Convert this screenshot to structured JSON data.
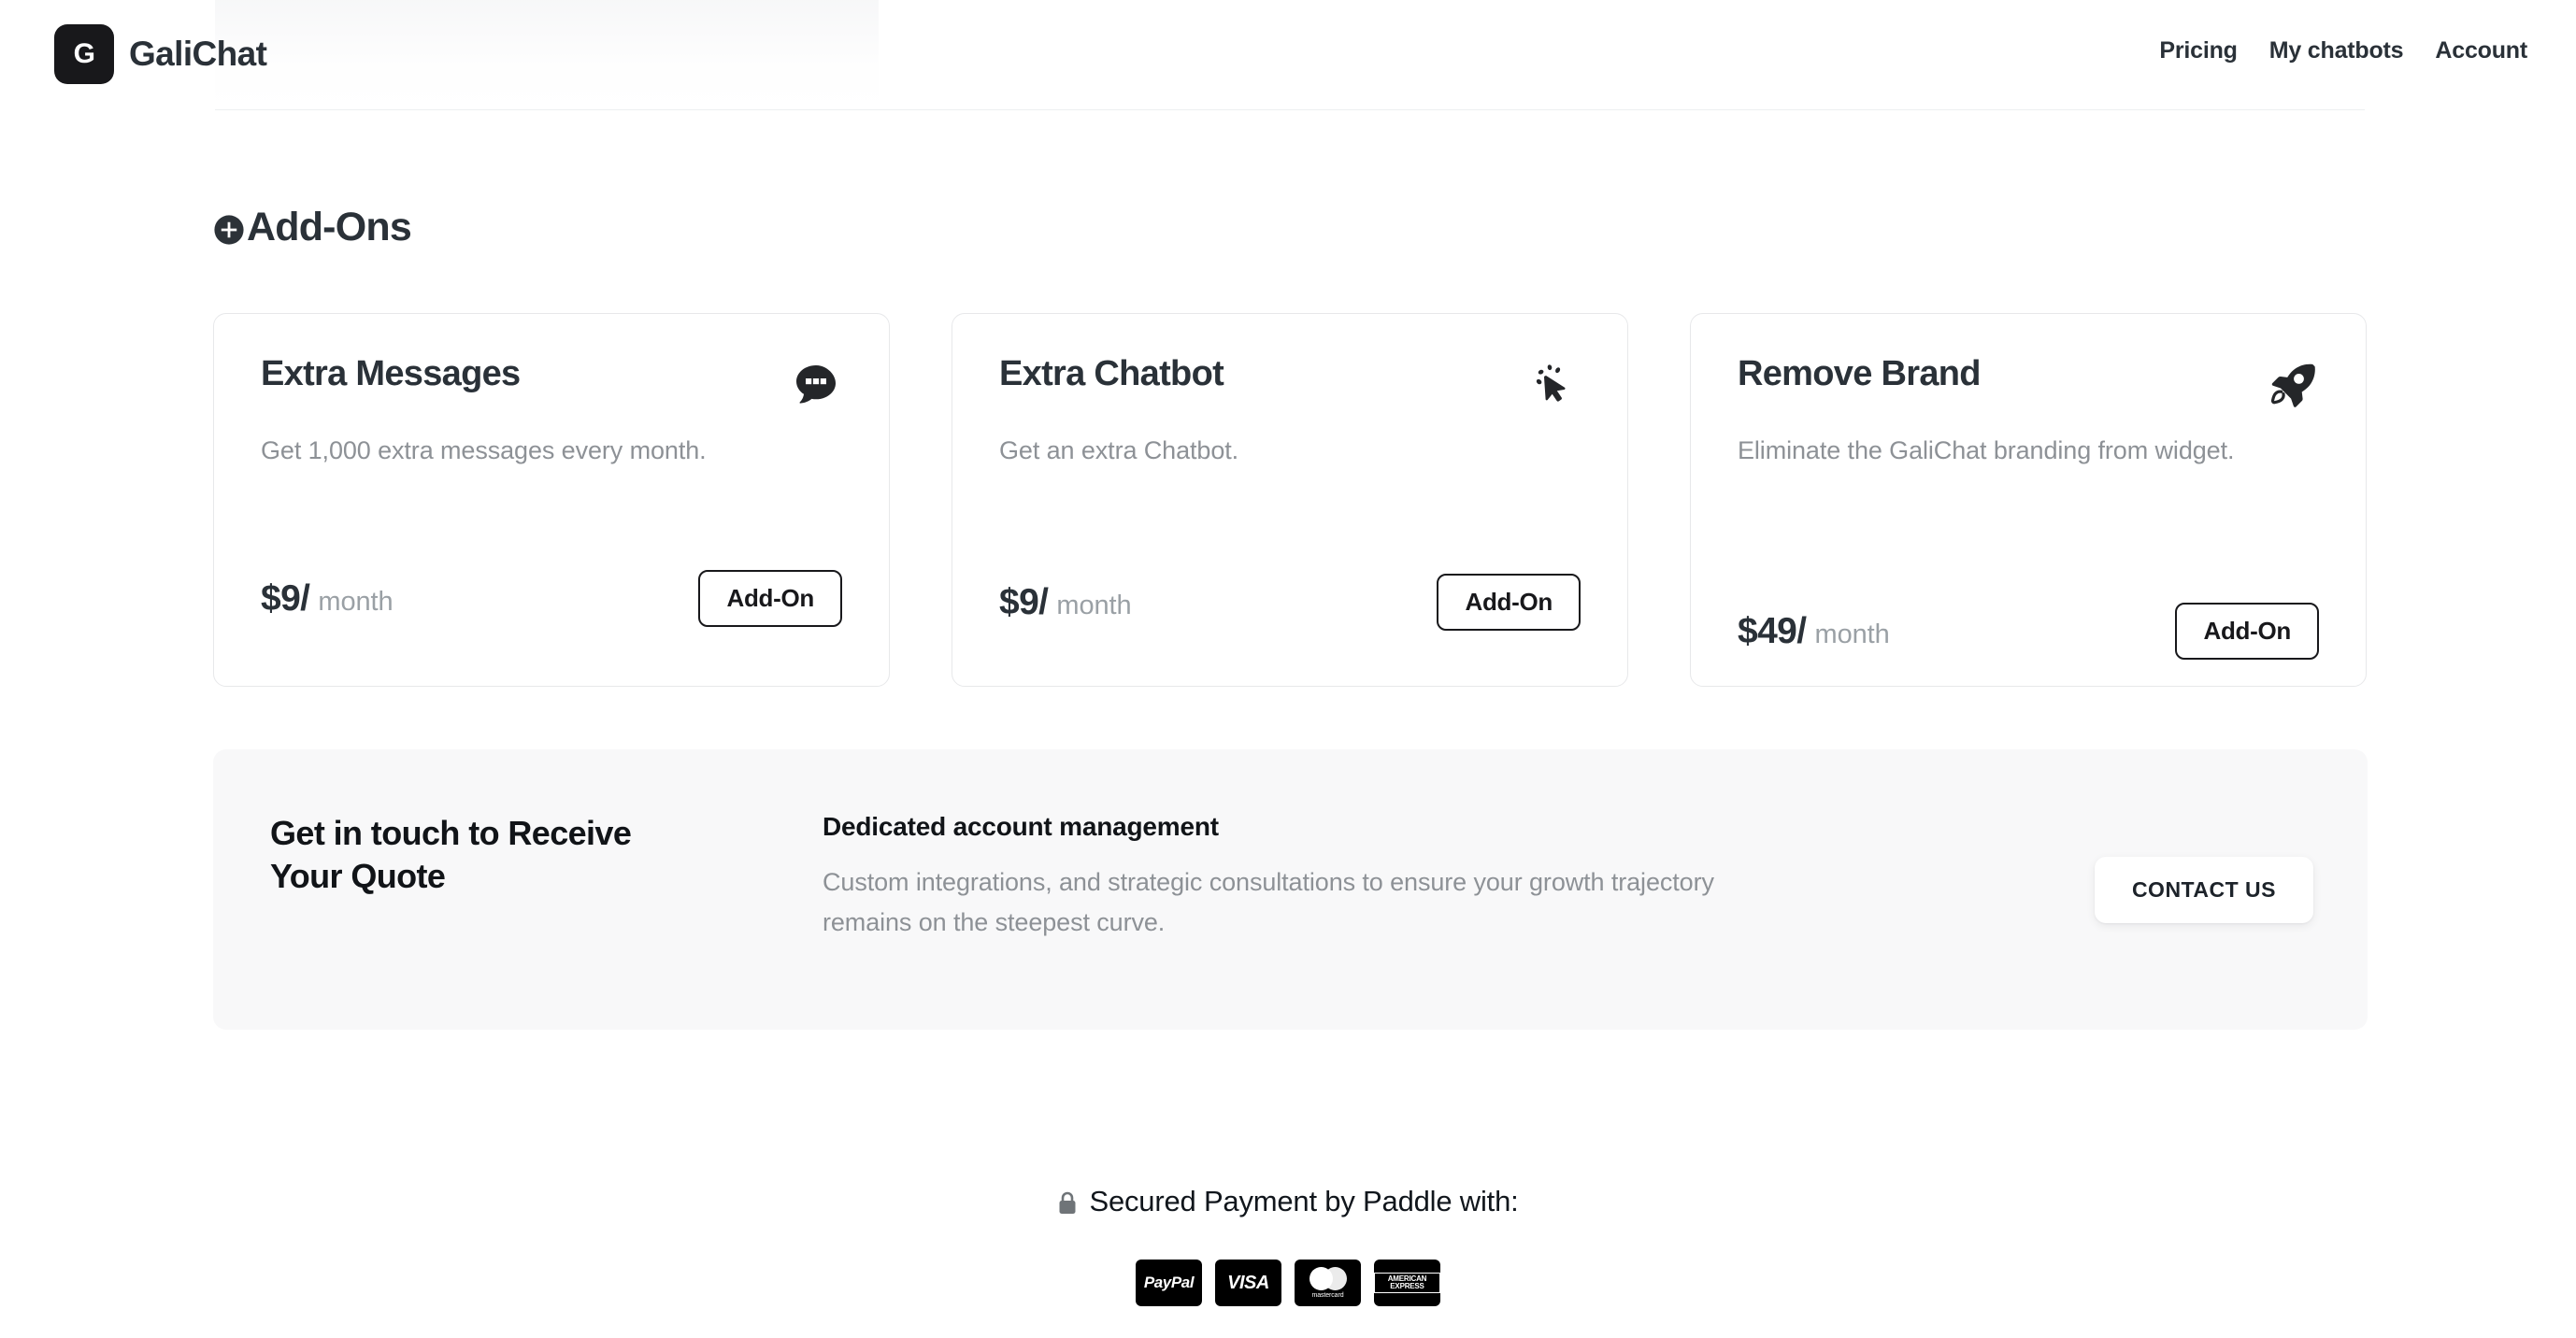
{
  "header": {
    "logo_letter": "G",
    "brand_name": "GaliChat",
    "nav": [
      {
        "label": "Pricing"
      },
      {
        "label": "My chatbots"
      },
      {
        "label": "Account"
      }
    ]
  },
  "addons_section": {
    "title": "Add-Ons",
    "title_icon": "plus-circle-icon",
    "cards": [
      {
        "title": "Extra Messages",
        "icon": "chat-bubble-dots-icon",
        "description": "Get 1,000 extra messages every month.",
        "price_amount": "$9/",
        "price_period": "month",
        "button_label": "Add-On"
      },
      {
        "title": "Extra Chatbot",
        "icon": "cursor-click-icon",
        "description": "Get an extra Chatbot.",
        "price_amount": "$9/",
        "price_period": "month",
        "button_label": "Add-On"
      },
      {
        "title": "Remove Brand",
        "icon": "rocket-icon",
        "description": "Eliminate the GaliChat branding from widget.",
        "price_amount": "$49/",
        "price_period": "month",
        "button_label": "Add-On"
      }
    ]
  },
  "quote_section": {
    "title": "Get in touch to Receive Your Quote",
    "subtitle": "Dedicated account management",
    "text": "Custom integrations, and strategic consultations to ensure your growth trajectory remains on the steepest curve.",
    "button_label": "CONTACT US"
  },
  "payment_footer": {
    "lock_icon": "lock-icon",
    "text": "Secured Payment by Paddle with:",
    "methods": [
      {
        "name": "PayPal",
        "icon": "paypal-logo"
      },
      {
        "name": "VISA",
        "icon": "visa-logo"
      },
      {
        "name": "mastercard",
        "icon": "mastercard-logo"
      },
      {
        "name": "AMERICAN EXPRESS",
        "icon": "amex-logo"
      }
    ]
  },
  "colors": {
    "text_dark": "#2a3138",
    "text_muted": "#8d9196",
    "card_border": "#e7e8ea",
    "banner_bg": "#f8f8f9",
    "logo_bg": "#18181b"
  }
}
